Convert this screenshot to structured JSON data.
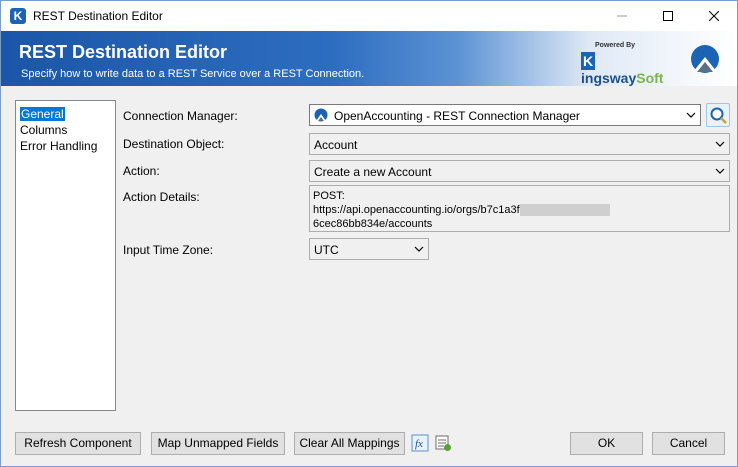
{
  "window": {
    "title": "REST Destination Editor"
  },
  "banner": {
    "title": "REST Destination Editor",
    "subtitle": "Specify how to write data to a REST Service over a REST Connection.",
    "brand_powered": "Powered By",
    "brand_name_k": "K",
    "brand_name_rest": "ingsway",
    "brand_name_soft": "Soft"
  },
  "nav": {
    "items": [
      "General",
      "Columns",
      "Error Handling"
    ],
    "selected": "General"
  },
  "form": {
    "connection_manager": {
      "label": "Connection Manager:",
      "value": "OpenAccounting - REST Connection Manager"
    },
    "destination_object": {
      "label": "Destination Object:",
      "value": "Account"
    },
    "action": {
      "label": "Action:",
      "value": "Create a new Account"
    },
    "action_details": {
      "label": "Action Details:",
      "method": "POST:",
      "url_start": "https://api.openaccounting.io/orgs/b7c1a3f",
      "url_end": "6cec86bb834e/accounts"
    },
    "time_zone": {
      "label": "Input Time Zone:",
      "value": "UTC"
    }
  },
  "footer": {
    "refresh": "Refresh Component",
    "map_unmapped": "Map Unmapped Fields",
    "clear_all": "Clear All Mappings",
    "ok": "OK",
    "cancel": "Cancel"
  }
}
